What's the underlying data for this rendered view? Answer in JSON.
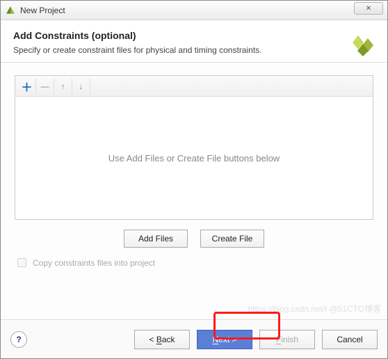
{
  "titlebar": {
    "title": "New Project",
    "close_glyph": "✕"
  },
  "header": {
    "heading": "Add Constraints (optional)",
    "subtext": "Specify or create constraint files for physical and timing constraints."
  },
  "toolbar": {
    "add_glyph": "＋",
    "remove_glyph": "—",
    "up_glyph": "↑",
    "down_glyph": "↓"
  },
  "panel": {
    "placeholder": "Use Add Files or Create File buttons below"
  },
  "buttons": {
    "add_files": "Add Files",
    "create_file": "Create File"
  },
  "checkbox": {
    "label": "Copy constraints files into project"
  },
  "footer": {
    "help_glyph": "?",
    "back_prefix": "< ",
    "back_hotkey": "B",
    "back_suffix": "ack",
    "next_hotkey": "N",
    "next_suffix": "ext >",
    "finish_prefix": "",
    "finish_hotkey": "F",
    "finish_suffix": "inish",
    "cancel": "Cancel"
  },
  "watermark": "https://blog.csdn.net/i @51CTO博客"
}
